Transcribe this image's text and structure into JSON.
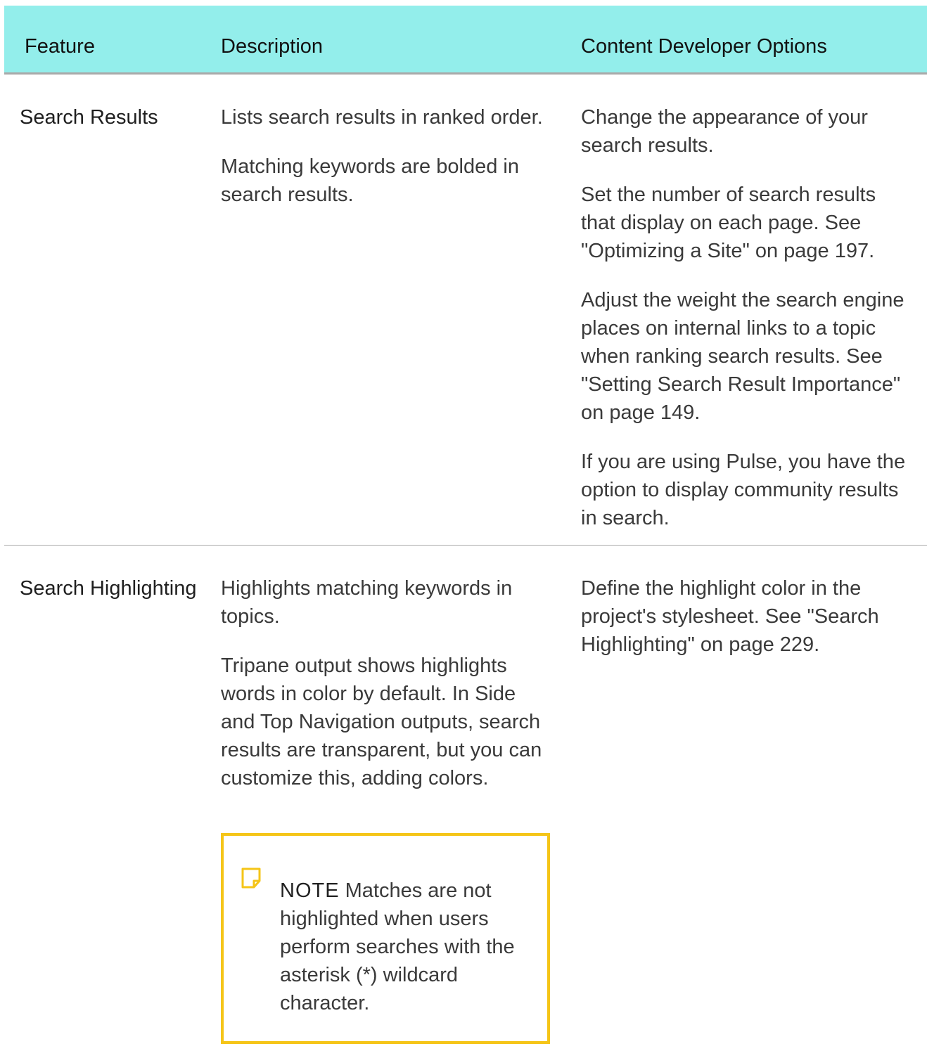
{
  "table": {
    "headers": [
      "Feature",
      "Description",
      "Content Developer Options"
    ],
    "rows": [
      {
        "feature": "Search Results",
        "description": [
          "Lists search results in ranked order.",
          "Matching keywords are bolded in search results."
        ],
        "options": [
          "Change the appearance of your search results.",
          "Set the number of search results that display on each page. See \"Optimizing a Site\" on page 197.",
          "Adjust the weight the search engine places on internal links to a topic when ranking search results. See \"Setting Search Result Importance\" on page 149.",
          "If you are using Pulse, you have the option to display community results in search."
        ]
      },
      {
        "feature": "Search Highlighting",
        "description": [
          "Highlights matching keywords in topics.",
          "Tripane output shows highlights words in color by default. In Side and Top Navigation outputs, search results are transparent, but you can customize this, adding colors."
        ],
        "note": {
          "label": "NOTE",
          "text": "Matches are not highlighted when users perform searches with the asterisk (*) wildcard character.",
          "icon": "note-icon"
        },
        "options": [
          "Define the highlight color in the project's stylesheet. See \"Search Highlighting\" on page 229."
        ]
      }
    ]
  },
  "colors": {
    "header_bg": "#93eeeb",
    "note_border": "#f5c518",
    "rule": "#a9a9a9"
  }
}
